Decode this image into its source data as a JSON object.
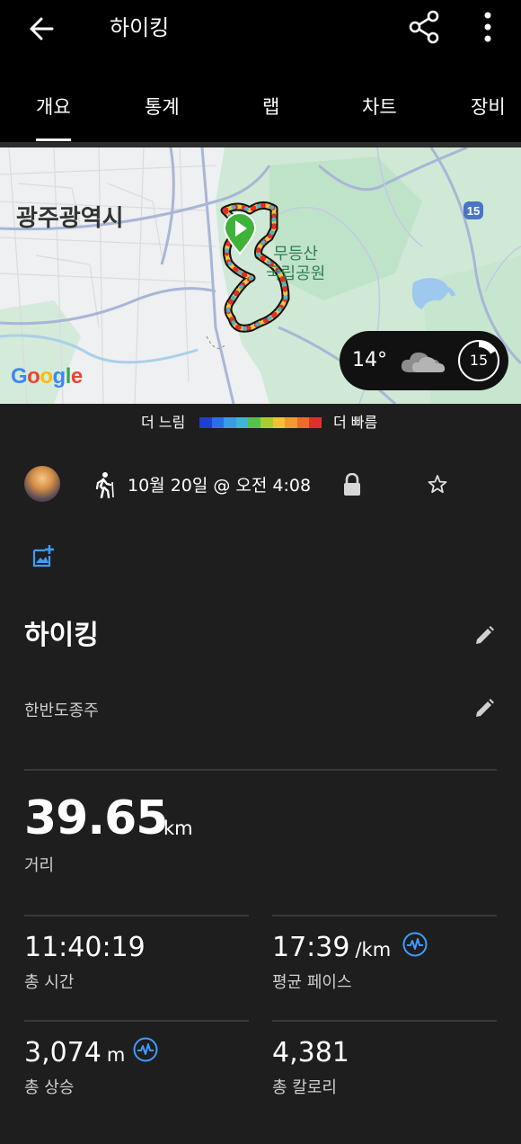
{
  "app_bar": {
    "title": "하이킹"
  },
  "tabs": [
    {
      "label": "개요",
      "active": true
    },
    {
      "label": "통계",
      "active": false
    },
    {
      "label": "랩",
      "active": false
    },
    {
      "label": "차트",
      "active": false
    },
    {
      "label": "장비",
      "active": false
    }
  ],
  "map": {
    "city_label": "광주광역시",
    "park_label_line1": "무등산",
    "park_label_line2": "국립공원",
    "road_badge": "15",
    "attribution": "Google",
    "weather": {
      "temperature": "14°",
      "icon": "cloud-icon",
      "wind": "15"
    }
  },
  "speed_legend": {
    "slow_label": "더 느림",
    "fast_label": "더 빠름",
    "colors": [
      "#1e3fcf",
      "#2b6fe6",
      "#3a9be8",
      "#3fb6d8",
      "#54c24a",
      "#a6cf2c",
      "#f1c232",
      "#f29a2c",
      "#ef6b2a",
      "#e0302a"
    ]
  },
  "activity": {
    "date": "10월 20일 @ 오전 4:08",
    "name": "하이킹",
    "description": "한반도종주"
  },
  "stats": {
    "distance": {
      "value": "39.65",
      "unit": "km",
      "label": "거리"
    },
    "total_time": {
      "value": "11:40:19",
      "label": "총 시간"
    },
    "avg_pace": {
      "value": "17:39",
      "unit": "/km",
      "label": "평균 페이스"
    },
    "total_ascent": {
      "value": "3,074",
      "unit": "m",
      "label": "총 상승"
    },
    "total_calories": {
      "value": "4,381",
      "label": "총 칼로리"
    }
  },
  "colors": {
    "accent_blue": "#3f9cff",
    "start_marker": "#3fb23a",
    "background": "#1e1e1e"
  }
}
